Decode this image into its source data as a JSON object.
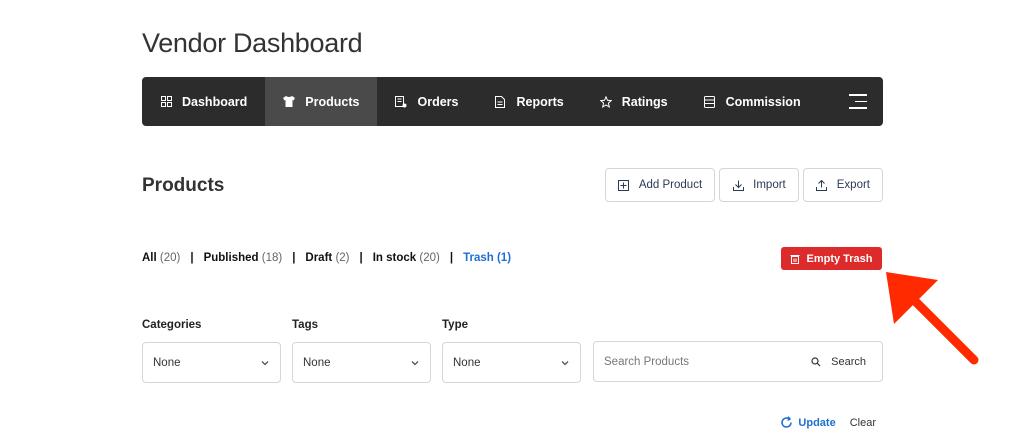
{
  "page": {
    "title": "Vendor Dashboard"
  },
  "nav": {
    "items": [
      {
        "label": "Dashboard",
        "icon": "grid-icon"
      },
      {
        "label": "Products",
        "icon": "shirt-icon",
        "active": true
      },
      {
        "label": "Orders",
        "icon": "orders-icon"
      },
      {
        "label": "Reports",
        "icon": "document-icon"
      },
      {
        "label": "Ratings",
        "icon": "star-icon"
      },
      {
        "label": "Commission",
        "icon": "wallet-icon"
      }
    ],
    "menu_icon": "hamburger-icon"
  },
  "products": {
    "title": "Products",
    "actions": {
      "add": "Add Product",
      "import": "Import",
      "export": "Export"
    },
    "filters": [
      {
        "label": "All",
        "count": "(20)"
      },
      {
        "label": "Published",
        "count": "(18)"
      },
      {
        "label": "Draft",
        "count": "(2)"
      },
      {
        "label": "In stock",
        "count": "(20)"
      },
      {
        "label": "Trash",
        "count": "(1)"
      }
    ],
    "separator": "|",
    "empty_trash": "Empty Trash"
  },
  "filter_form": {
    "categories": {
      "label": "Categories",
      "value": "None"
    },
    "tags": {
      "label": "Tags",
      "value": "None"
    },
    "type": {
      "label": "Type",
      "value": "None"
    },
    "search": {
      "placeholder": "Search Products",
      "button": "Search"
    },
    "update": "Update",
    "clear": "Clear"
  },
  "colors": {
    "navbar": "#2c2c2c",
    "active_tab": "#4a4a4a",
    "danger": "#dd2a2a",
    "link": "#1f6fd1",
    "annotation_arrow": "#ff2a00"
  }
}
